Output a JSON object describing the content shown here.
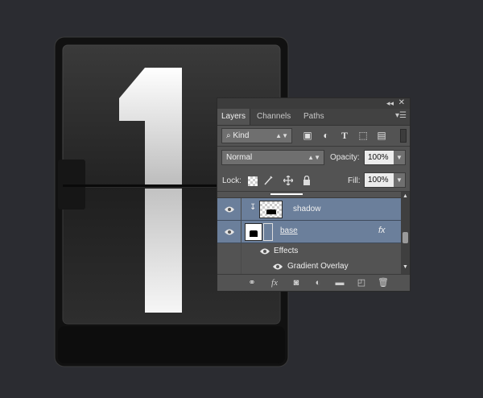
{
  "artwork": {
    "digit": "1",
    "colors": {
      "background": "#2b2c31",
      "card": "#2a2a2a",
      "digit_top": "#f4f4f4",
      "digit_bottom": "#d4d4d4"
    }
  },
  "panel": {
    "collapse_icon": "double-chevron-right-icon",
    "close_icon": "close-icon",
    "tabs": [
      {
        "label": "Layers",
        "active": true
      },
      {
        "label": "Channels",
        "active": false
      },
      {
        "label": "Paths",
        "active": false
      }
    ],
    "menu_icon": "panel-menu-icon",
    "filter": {
      "kind_label": "Kind",
      "search_icon": "search-icon",
      "icons": [
        "image-filter-icon",
        "adjustment-filter-icon",
        "type-filter-icon",
        "shape-filter-icon",
        "smart-object-filter-icon"
      ]
    },
    "blend_mode": "Normal",
    "opacity_label": "Opacity:",
    "opacity_value": "100%",
    "lock_label": "Lock:",
    "lock_icons": [
      "lock-transparent-icon",
      "lock-image-icon",
      "lock-position-icon",
      "lock-all-icon"
    ],
    "fill_label": "Fill:",
    "fill_value": "100%",
    "layers": [
      {
        "name": "shadow",
        "visible": true,
        "selected": true,
        "clipped": true
      },
      {
        "name": "base",
        "visible": true,
        "selected": true,
        "has_fx": true,
        "fx_label": "fx"
      }
    ],
    "effects_label": "Effects",
    "effect_items": [
      "Gradient Overlay"
    ],
    "bottom_icons": [
      "link-layers-icon",
      "fx-icon",
      "add-mask-icon",
      "adjustment-layer-icon",
      "new-group-icon",
      "new-layer-icon",
      "trash-icon"
    ],
    "bottom_fx_label": "fx"
  }
}
